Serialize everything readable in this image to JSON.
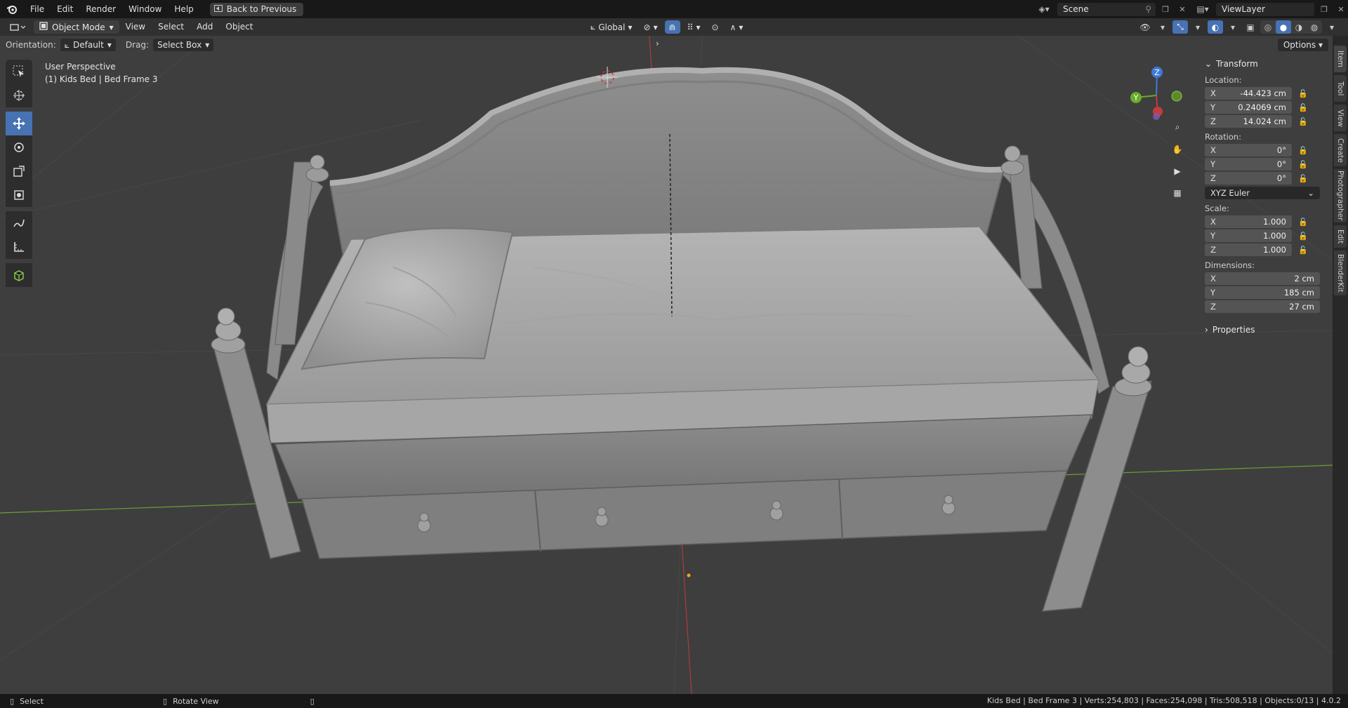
{
  "menubar": {
    "items": [
      "File",
      "Edit",
      "Render",
      "Window",
      "Help"
    ],
    "back_button": "Back to Previous",
    "scene": "Scene",
    "view_layer": "ViewLayer"
  },
  "header": {
    "mode": "Object Mode",
    "menus": [
      "View",
      "Select",
      "Add",
      "Object"
    ],
    "transform_orientation": "Global"
  },
  "tool_settings": {
    "orientation_label": "Orientation:",
    "orientation_value": "Default",
    "drag_label": "Drag:",
    "drag_value": "Select Box",
    "options": "Options"
  },
  "viewport": {
    "perspective": "User Perspective",
    "active_object": "(1) Kids Bed | Bed Frame 3",
    "gizmo": {
      "z": "Z",
      "y": "Y"
    }
  },
  "transform_panel": {
    "title": "Transform",
    "location_label": "Location:",
    "location": [
      {
        "axis": "X",
        "value": "-44.423 cm"
      },
      {
        "axis": "Y",
        "value": "0.24069 cm"
      },
      {
        "axis": "Z",
        "value": "14.024 cm"
      }
    ],
    "rotation_label": "Rotation:",
    "rotation": [
      {
        "axis": "X",
        "value": "0°"
      },
      {
        "axis": "Y",
        "value": "0°"
      },
      {
        "axis": "Z",
        "value": "0°"
      }
    ],
    "rotation_mode": "XYZ Euler",
    "scale_label": "Scale:",
    "scale": [
      {
        "axis": "X",
        "value": "1.000"
      },
      {
        "axis": "Y",
        "value": "1.000"
      },
      {
        "axis": "Z",
        "value": "1.000"
      }
    ],
    "dimensions_label": "Dimensions:",
    "dimensions": [
      {
        "axis": "X",
        "value": "2 cm"
      },
      {
        "axis": "Y",
        "value": "185 cm"
      },
      {
        "axis": "Z",
        "value": "27 cm"
      }
    ],
    "properties_title": "Properties"
  },
  "side_tabs": [
    "Item",
    "Tool",
    "View",
    "Create",
    "Photographer",
    "Edit",
    "BlenderKit"
  ],
  "statusbar": {
    "select": "Select",
    "rotate": "Rotate View",
    "info": "Kids Bed | Bed Frame 3 | Verts:254,803 | Faces:254,098 | Tris:508,518 | Objects:0/13 | 4.0.2"
  },
  "colors": {
    "accent": "#4772b3",
    "viewport_bg": "#3e3e3e",
    "x_axis": "#c33c3c",
    "y_axis": "#6aab2a",
    "z_axis": "#3f7ad6"
  }
}
